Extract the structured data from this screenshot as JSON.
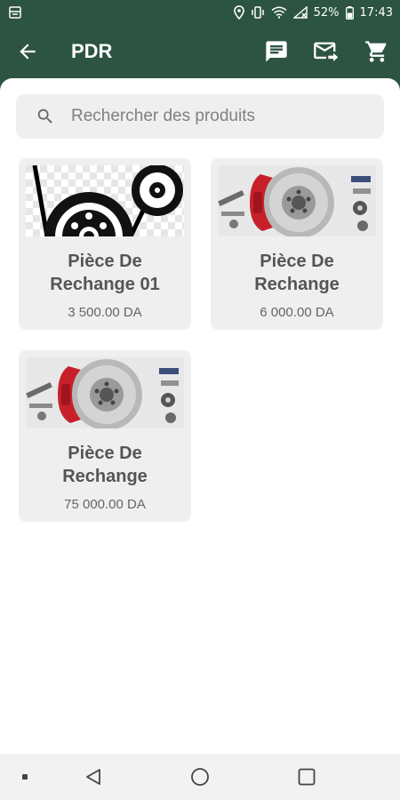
{
  "status_bar": {
    "battery": "52%",
    "time": "17:43"
  },
  "app_bar": {
    "title": "PDR",
    "icons": [
      "back-arrow-icon",
      "chat-icon",
      "message-forward-icon",
      "cart-icon"
    ]
  },
  "search": {
    "placeholder": "Rechercher des produits",
    "value": ""
  },
  "products": [
    {
      "name": "Pièce De\nRechange  01",
      "price": "3 500.00 DA",
      "image": "timing-belt-parts"
    },
    {
      "name": "Pièce De\nRechange",
      "price": "6 000.00 DA",
      "image": "brake-disc-parts"
    },
    {
      "name": "Pièce De\nRechange",
      "price": "75 000.00 DA",
      "image": "brake-disc-parts"
    }
  ],
  "colors": {
    "primary": "#2d5443",
    "card_bg": "#efefef",
    "caliper_red": "#c8202a"
  }
}
